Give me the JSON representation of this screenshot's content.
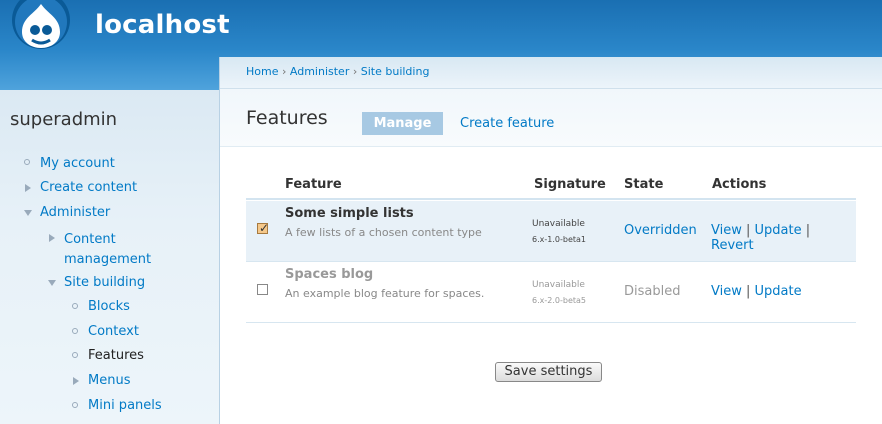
{
  "header": {
    "site_name": "localhost",
    "colors": {
      "header_top": "#1a6fb2",
      "header_bottom": "#4fa3dc",
      "link": "#027ac6"
    }
  },
  "sidebar": {
    "user": "superadmin",
    "items": [
      {
        "label": "My account",
        "bullet": "circle"
      },
      {
        "label": "Create content",
        "bullet": "collapsed-triangle"
      },
      {
        "label": "Administer",
        "bullet": "expanded-triangle"
      },
      {
        "label": "Content management",
        "label_lines": [
          "Content",
          "management"
        ],
        "bullet": "collapsed-triangle"
      },
      {
        "label": "Site building",
        "bullet": "expanded-triangle"
      },
      {
        "label": "Blocks",
        "bullet": "circle"
      },
      {
        "label": "Context",
        "bullet": "circle"
      },
      {
        "label": "Features",
        "bullet": "circle",
        "active": true
      },
      {
        "label": "Menus",
        "bullet": "collapsed-triangle"
      },
      {
        "label": "Mini panels",
        "bullet": "circle"
      }
    ]
  },
  "breadcrumb": {
    "items": [
      "Home",
      "Administer",
      "Site building"
    ],
    "separator": "›"
  },
  "page": {
    "title": "Features",
    "tabs": [
      {
        "label": "Manage",
        "active": true
      },
      {
        "label": "Create feature",
        "active": false
      }
    ]
  },
  "table": {
    "headers": [
      "Feature",
      "Signature",
      "State",
      "Actions"
    ],
    "rows": [
      {
        "checked": true,
        "name": "Some simple lists",
        "description": "A few lists of a chosen content type",
        "signature_status": "Unavailable",
        "signature_version": "6.x-1.0-beta1",
        "state": "Overridden",
        "actions": [
          "View",
          "Update",
          "Revert"
        ]
      },
      {
        "checked": false,
        "name": "Spaces blog",
        "description": "An example blog feature for spaces.",
        "signature_status": "Unavailable",
        "signature_version": "6.x-2.0-beta5",
        "state": "Disabled",
        "actions": [
          "View",
          "Update"
        ]
      }
    ]
  },
  "form": {
    "save_label": "Save settings"
  }
}
